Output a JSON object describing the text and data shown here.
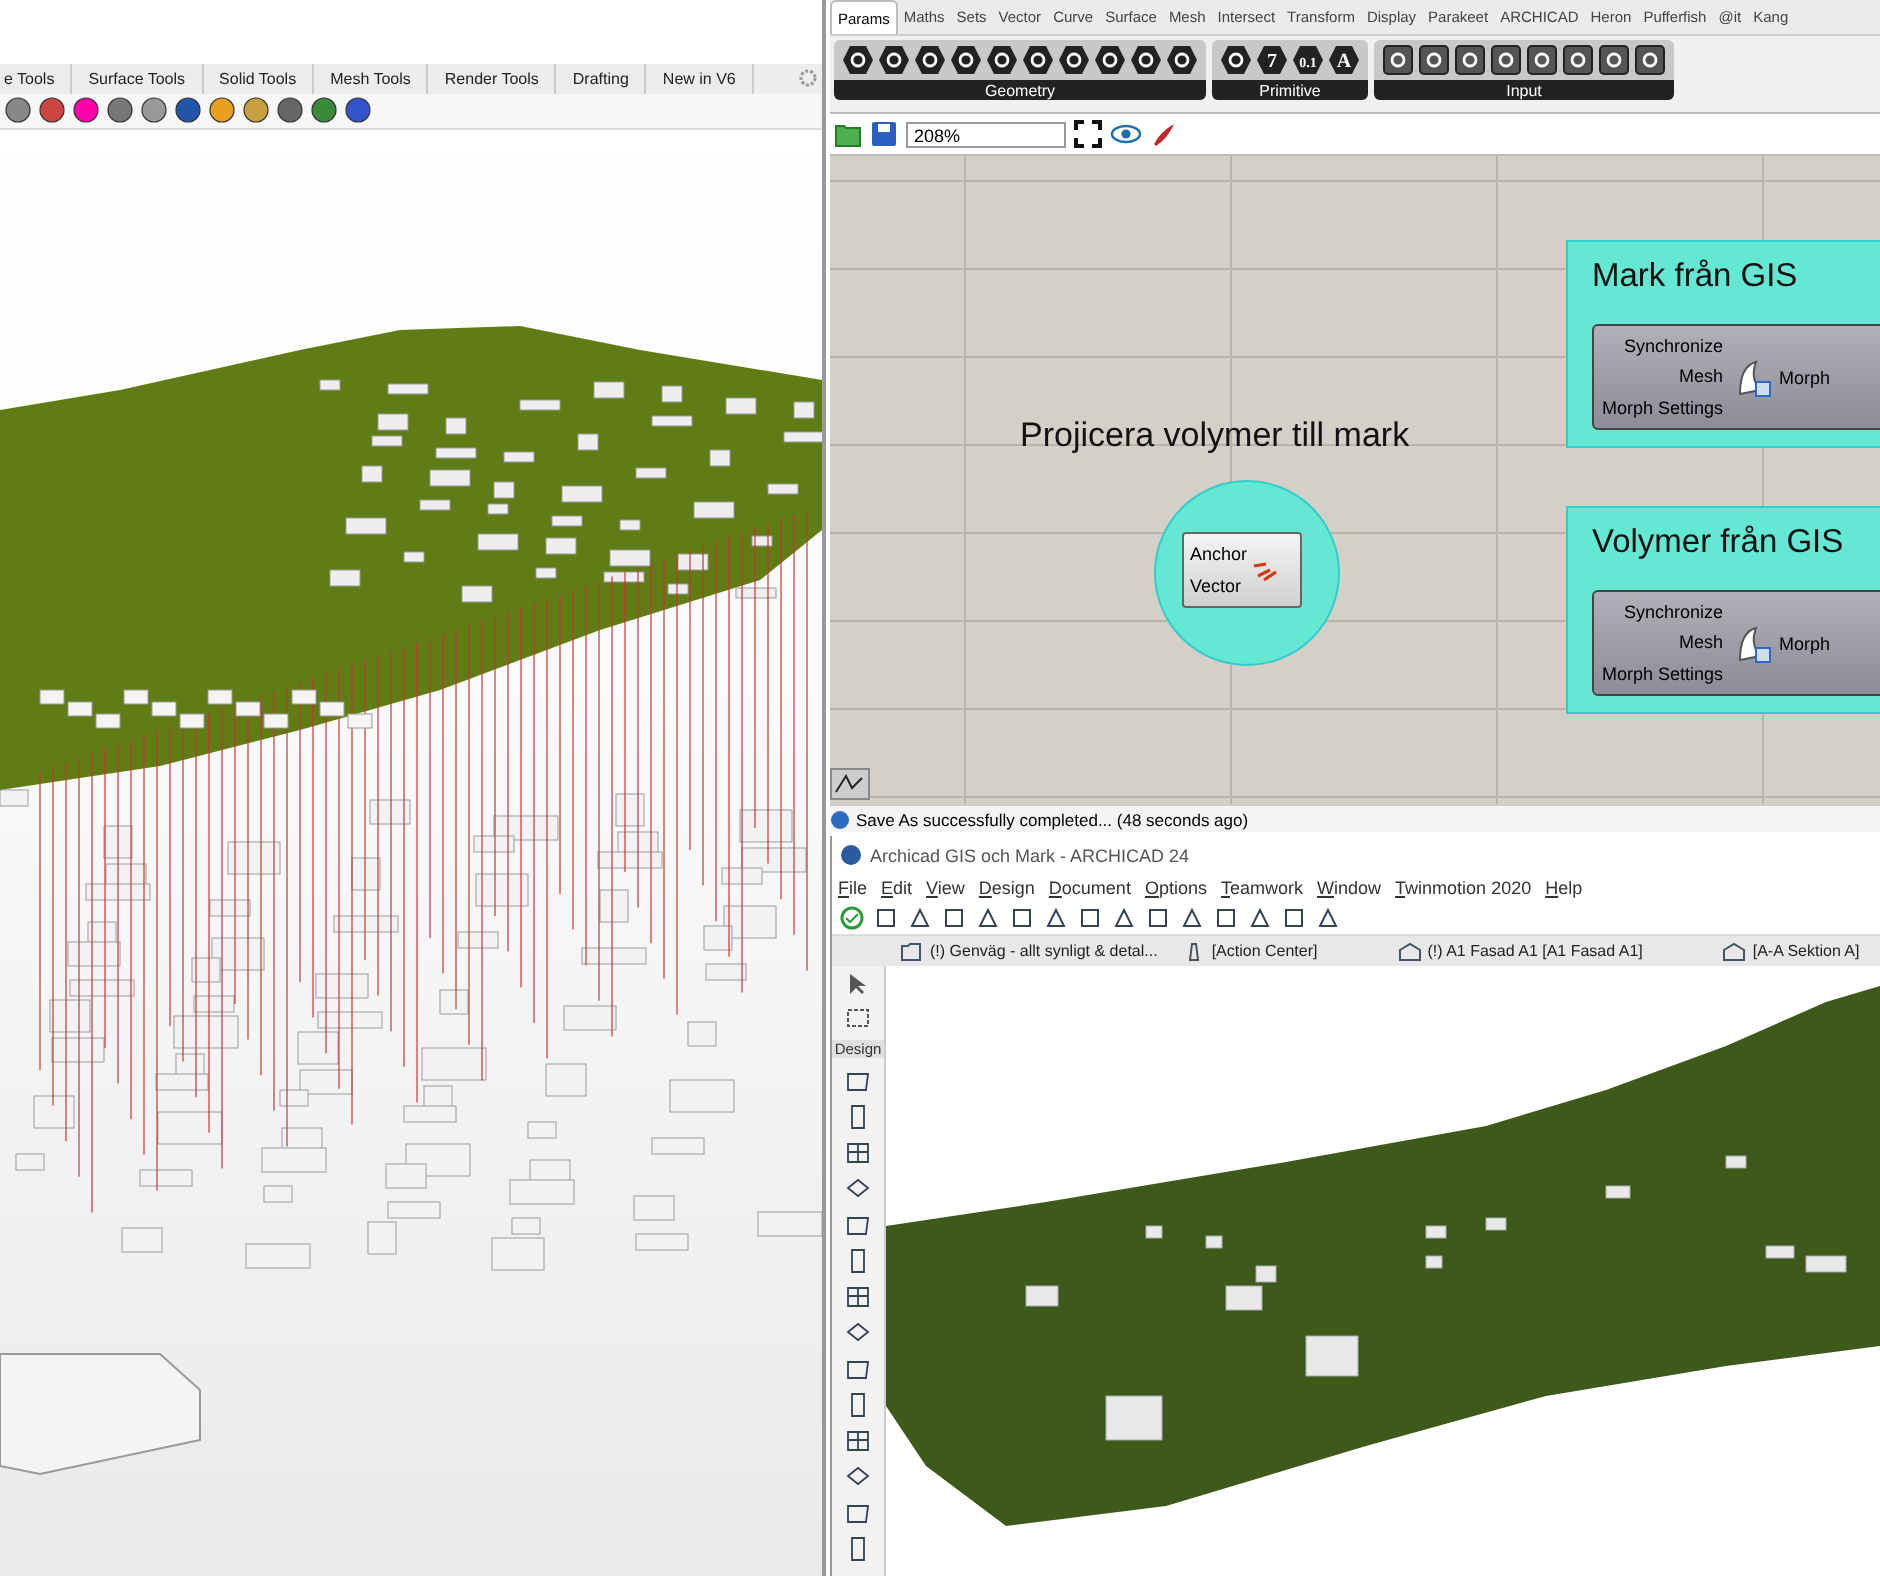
{
  "rhino": {
    "tabs": [
      {
        "label": "e Tools"
      },
      {
        "label": "Surface Tools"
      },
      {
        "label": "Solid Tools"
      },
      {
        "label": "Mesh Tools"
      },
      {
        "label": "Render Tools"
      },
      {
        "label": "Drafting"
      },
      {
        "label": "New in V6"
      }
    ]
  },
  "grasshopper": {
    "tabs": [
      {
        "label": "Params",
        "selected": true
      },
      {
        "label": "Maths",
        "selected": false
      },
      {
        "label": "Sets",
        "selected": false
      },
      {
        "label": "Vector",
        "selected": false
      },
      {
        "label": "Curve",
        "selected": false
      },
      {
        "label": "Surface",
        "selected": false
      },
      {
        "label": "Mesh",
        "selected": false
      },
      {
        "label": "Intersect",
        "selected": false
      },
      {
        "label": "Transform",
        "selected": false
      },
      {
        "label": "Display",
        "selected": false
      },
      {
        "label": "Parakeet",
        "selected": false
      },
      {
        "label": "ARCHICAD",
        "selected": false
      },
      {
        "label": "Heron",
        "selected": false
      },
      {
        "label": "Pufferfish",
        "selected": false
      },
      {
        "label": "@it",
        "selected": false
      },
      {
        "label": "Kang",
        "selected": false
      }
    ],
    "panels": [
      {
        "label": "Geometry",
        "kind": "hex"
      },
      {
        "label": "Primitive",
        "kind": "hex",
        "glyphs": [
          "7",
          "0.1",
          "A"
        ]
      },
      {
        "label": "Input",
        "kind": "square"
      }
    ],
    "zoom": "208%",
    "projection": {
      "title": "Projicera volymer till mark",
      "inputs": [
        "Anchor",
        "Vector"
      ]
    },
    "groups": [
      {
        "title": "Mark från GIS",
        "inputs": [
          "Synchronize",
          "Mesh",
          "Morph Settings"
        ],
        "output": "Morph"
      },
      {
        "title": "Volymer från GIS",
        "inputs": [
          "Synchronize",
          "Mesh",
          "Morph Settings"
        ],
        "output": "Morph"
      }
    ],
    "status": "Save As successfully completed... (48 seconds ago)"
  },
  "archicad": {
    "title": "Archicad GIS och Mark - ARCHICAD 24",
    "menu": [
      "File",
      "Edit",
      "View",
      "Design",
      "Document",
      "Options",
      "Teamwork",
      "Window",
      "Twinmotion 2020",
      "Help"
    ],
    "view_tabs": [
      {
        "label": "(!) Genväg - allt synligt & detal...",
        "kind": "folder"
      },
      {
        "label": "[Action Center]",
        "kind": "lighthouse"
      },
      {
        "label": "(!) A1 Fasad A1 [A1 Fasad A1]",
        "kind": "house"
      },
      {
        "label": "[A-A Sektion A]",
        "kind": "house"
      }
    ],
    "toolbox_label": "Design"
  }
}
